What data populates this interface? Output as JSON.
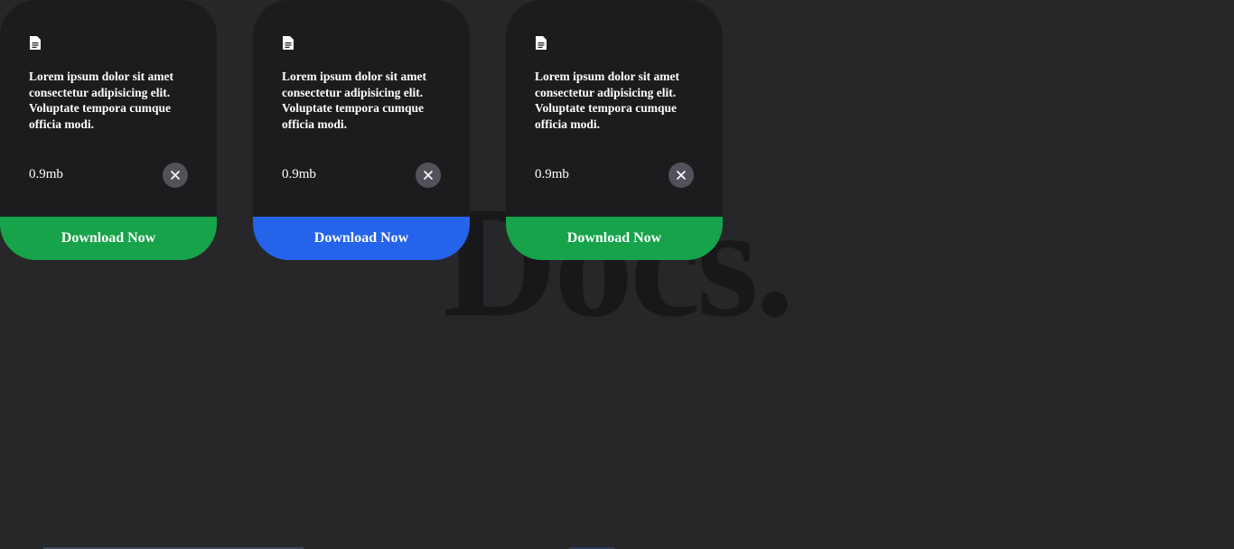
{
  "background_title": "Docs.",
  "cards": [
    {
      "icon": "file-icon",
      "description": "Lorem ipsum dolor sit amet consectetur adipisicing elit. Voluptate tempora cumque officia modi.",
      "size": "0.9mb",
      "close_label": "✕",
      "download_label": "Download Now",
      "accent_color": "#16a34a"
    },
    {
      "icon": "file-icon",
      "description": "Lorem ipsum dolor sit amet consectetur adipisicing elit. Voluptate tempora cumque officia modi.",
      "size": "0.9mb",
      "close_label": "✕",
      "download_label": "Download Now",
      "accent_color": "#2563eb"
    },
    {
      "icon": "file-icon",
      "description": "Lorem ipsum dolor sit amet consectetur adipisicing elit. Voluptate tempora cumque officia modi.",
      "size": "0.9mb",
      "close_label": "✕",
      "download_label": "Download Now",
      "accent_color": "#16a34a"
    }
  ],
  "colors": {
    "page_background": "#27272a",
    "card_background": "#1c1c1f",
    "close_button": "#52525b",
    "title_text": "#18181b"
  }
}
